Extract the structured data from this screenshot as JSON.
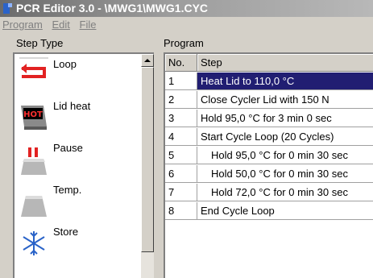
{
  "window": {
    "title": "PCR Editor 3.0 - \\MWG1\\MWG1.CYC"
  },
  "menu": [
    "Program",
    "Edit",
    "File"
  ],
  "step_type": {
    "label": "Step Type",
    "items": [
      {
        "label": "Loop",
        "icon": "loop-icon"
      },
      {
        "label": "Lid heat",
        "icon": "lid-heat-icon",
        "icon_text": "HOT"
      },
      {
        "label": "Pause",
        "icon": "pause-icon"
      },
      {
        "label": "Temp.",
        "icon": "temperature-icon"
      },
      {
        "label": "Store",
        "icon": "snowflake-icon"
      }
    ]
  },
  "program": {
    "label": "Program",
    "columns": [
      "No.",
      "Step"
    ],
    "selected_row": 1,
    "rows": [
      {
        "no": "1",
        "step": "Heat Lid to 110,0 °C"
      },
      {
        "no": "2",
        "step": "Close Cycler Lid with 150 N"
      },
      {
        "no": "3",
        "step": "Hold 95,0 °C for 3 min 0 sec"
      },
      {
        "no": "4",
        "step": "Start Cycle Loop (20 Cycles)"
      },
      {
        "no": "5",
        "step": "Hold 95,0 °C for 0 min 30 sec"
      },
      {
        "no": "6",
        "step": "Hold 50,0 °C for 0 min 30 sec"
      },
      {
        "no": "7",
        "step": "Hold 72,0 °C for 0 min 30 sec"
      },
      {
        "no": "8",
        "step": "End Cycle Loop"
      }
    ]
  },
  "colors": {
    "selection": "#211e72",
    "title_gradient_start": "#6b6b6b",
    "face": "#d4d0c8"
  }
}
